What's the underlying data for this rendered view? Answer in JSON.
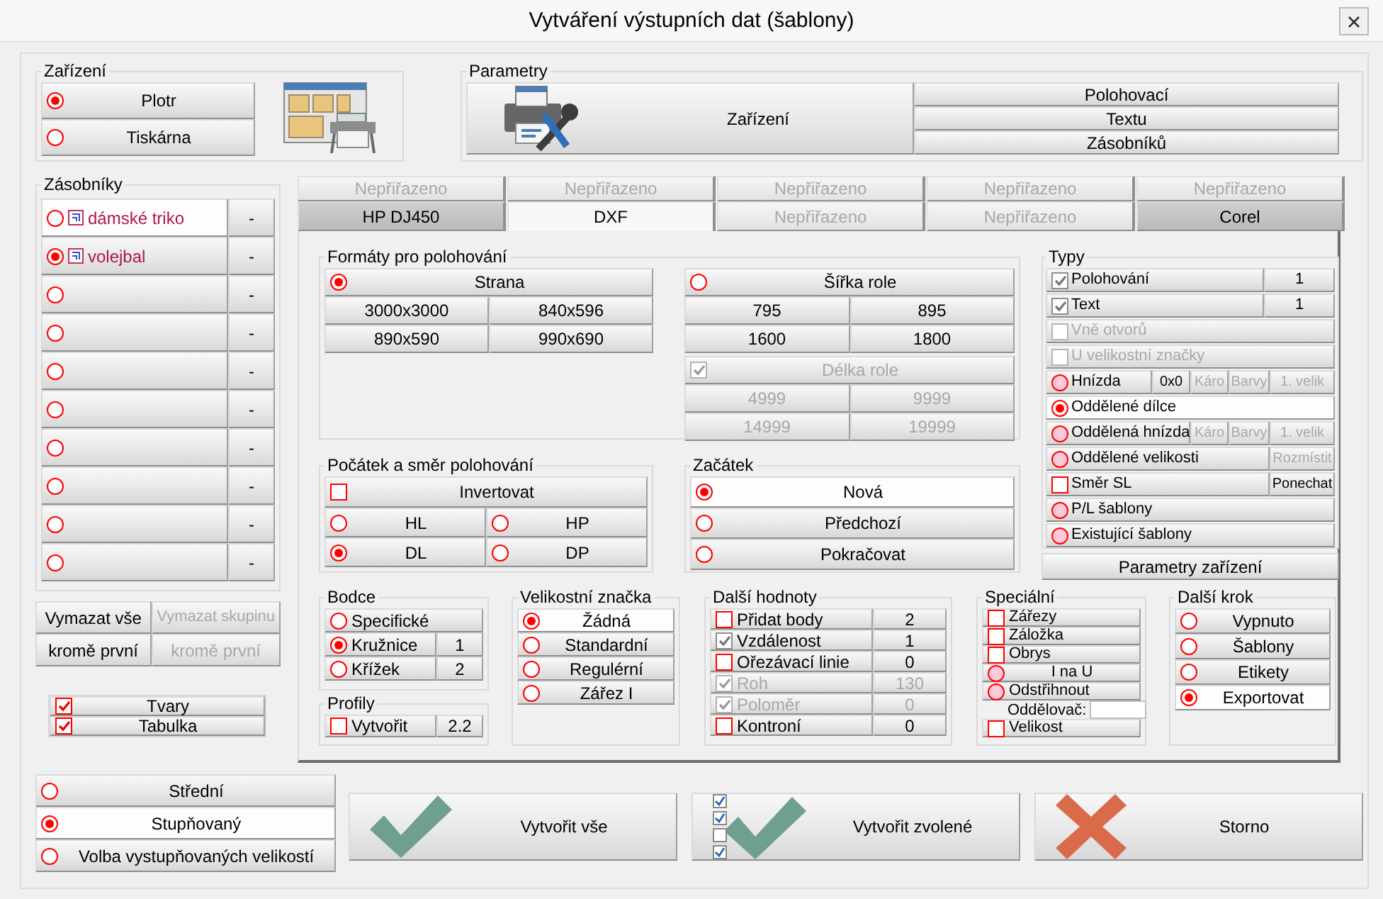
{
  "window": {
    "title": "Vytváření výstupních dat (šablony)"
  },
  "device": {
    "title": "Zařízení",
    "options": [
      {
        "label": "Plotr",
        "selected": true
      },
      {
        "label": "Tiskárna",
        "selected": false
      }
    ]
  },
  "parameters": {
    "title": "Parametry",
    "main_button": "Zařízení",
    "buttons": [
      "Polohovací",
      "Textu",
      "Zásobníků"
    ]
  },
  "bins": {
    "title": "Zásobníky",
    "items": [
      {
        "label": "dámské triko",
        "selected": false,
        "highlighted": true,
        "action": "-"
      },
      {
        "label": "volejbal",
        "selected": true,
        "highlighted": false,
        "action": "-"
      },
      {
        "selected": false,
        "highlighted": false,
        "action": "-"
      },
      {
        "selected": false,
        "highlighted": false,
        "action": "-"
      },
      {
        "selected": false,
        "highlighted": false,
        "action": "-"
      },
      {
        "selected": false,
        "highlighted": false,
        "action": "-"
      },
      {
        "selected": false,
        "highlighted": false,
        "action": "-"
      },
      {
        "selected": false,
        "highlighted": false,
        "action": "-"
      },
      {
        "selected": false,
        "highlighted": false,
        "action": "-"
      },
      {
        "selected": false,
        "highlighted": false,
        "action": "-"
      }
    ]
  },
  "clear_buttons": [
    {
      "label": "Vymazat vše",
      "disabled": false
    },
    {
      "label": "Vymazat skupinu",
      "disabled": true
    },
    {
      "label": "kromě první",
      "disabled": false
    },
    {
      "label": "kromě první",
      "disabled": true
    }
  ],
  "outputs": [
    {
      "label": "Tvary",
      "checked": true
    },
    {
      "label": "Tabulka",
      "checked": true
    }
  ],
  "tabs": {
    "row_1": [
      {
        "label": "Nepřiřazeno",
        "selected": false,
        "disabled": true
      },
      {
        "label": "Nepřiřazeno",
        "selected": false,
        "disabled": true
      },
      {
        "label": "Nepřiřazeno",
        "selected": false,
        "disabled": true
      },
      {
        "label": "Nepřiřazeno",
        "selected": false,
        "disabled": true
      },
      {
        "label": "Nepřiřazeno",
        "selected": false,
        "disabled": true
      }
    ],
    "row_2": [
      {
        "label": "HP DJ450",
        "selected": false,
        "disabled": false
      },
      {
        "label": "DXF",
        "selected": true,
        "disabled": false
      },
      {
        "label": "Nepřiřazeno",
        "selected": false,
        "disabled": true
      },
      {
        "label": "Nepřiřazeno",
        "selected": false,
        "disabled": true
      },
      {
        "label": "Corel",
        "selected": false,
        "disabled": false
      }
    ]
  },
  "formats": {
    "title": "Formáty pro polohování",
    "page": {
      "label": "Strana",
      "selected": true,
      "sizes": [
        "3000x3000",
        "840x596",
        "890x590",
        "990x690"
      ]
    },
    "roll_width": {
      "label": "Šířka role",
      "selected": false,
      "sizes": [
        "795",
        "895",
        "1600",
        "1800"
      ]
    },
    "roll_length": {
      "label": "Délka role",
      "checked": true,
      "disabled": true,
      "sizes": [
        "4999",
        "9999",
        "14999",
        "19999"
      ]
    }
  },
  "origin": {
    "title": "Počátek a směr polohování",
    "invert": {
      "label": "Invertovat",
      "checked": false
    },
    "corners": [
      {
        "label": "HL",
        "selected": false
      },
      {
        "label": "HP",
        "selected": false
      },
      {
        "label": "DL",
        "selected": true
      },
      {
        "label": "DP",
        "selected": false
      }
    ]
  },
  "start": {
    "title": "Začátek",
    "options": [
      {
        "label": "Nová",
        "selected": true
      },
      {
        "label": "Předchozí",
        "selected": false
      },
      {
        "label": "Pokračovat",
        "selected": false
      }
    ]
  },
  "types": {
    "title": "Typy",
    "rows": [
      {
        "kind": "check",
        "label": "Polohování",
        "checked": true,
        "disabled": false,
        "value": "1"
      },
      {
        "kind": "check",
        "label": "Text",
        "checked": true,
        "disabled": false,
        "value": "1"
      },
      {
        "kind": "check",
        "label": "Vně otvorů",
        "checked": false,
        "disabled": true
      },
      {
        "kind": "check",
        "label": "U velikostní značky",
        "checked": false,
        "disabled": true
      },
      {
        "kind": "radio",
        "label": "Hnízda",
        "selected": false,
        "extras": [
          {
            "label": "0x0",
            "disabled": false
          },
          {
            "label": "Káro",
            "disabled": true
          },
          {
            "label": "Barvy",
            "disabled": true
          },
          {
            "label": "1. velik",
            "disabled": true
          }
        ]
      },
      {
        "kind": "radio",
        "label": "Oddělené dílce",
        "selected": true
      },
      {
        "kind": "radio",
        "label": "Oddělená hnízda",
        "selected": false,
        "extras": [
          {
            "label": "Káro",
            "disabled": true
          },
          {
            "label": "Barvy",
            "disabled": true
          },
          {
            "label": "1. velik",
            "disabled": true
          }
        ]
      },
      {
        "kind": "radio",
        "label": "Oddělené velikosti",
        "selected": false,
        "extras": [
          {
            "label": "Rozmístit",
            "disabled": true
          }
        ]
      },
      {
        "kind": "check",
        "label": "Směr SL",
        "checked": false,
        "disabled": false,
        "extras": [
          {
            "label": "Ponechat",
            "disabled": false
          }
        ]
      },
      {
        "kind": "radio",
        "label": "P/L šablony",
        "selected": false
      },
      {
        "kind": "radio",
        "label": "Existující šablony",
        "selected": false
      }
    ]
  },
  "device_parameters_button": "Parametry zařízení",
  "spikes": {
    "title": "Bodce",
    "options": [
      {
        "label": "Specifické",
        "selected": false
      },
      {
        "label": "Kružnice",
        "selected": true,
        "value": "1"
      },
      {
        "label": "Křížek",
        "selected": false,
        "value": "2"
      }
    ]
  },
  "profiles": {
    "title": "Profily",
    "create": {
      "label": "Vytvořit",
      "checked": false,
      "value": "2.2"
    }
  },
  "size_mark": {
    "title": "Velikostní značka",
    "options": [
      {
        "label": "Žádná",
        "selected": true
      },
      {
        "label": "Standardní",
        "selected": false
      },
      {
        "label": "Regulérní",
        "selected": false
      },
      {
        "label": "Zářez I",
        "selected": false
      }
    ]
  },
  "more_values": {
    "title": "Další hodnoty",
    "rows": [
      {
        "label": "Přidat body",
        "checked": false,
        "disabled": false,
        "value": "2"
      },
      {
        "label": "Vzdálenost",
        "checked": true,
        "disabled": false,
        "value": "1"
      },
      {
        "label": "Ořezávací linie",
        "checked": false,
        "disabled": false,
        "value": "0"
      },
      {
        "label": "Roh",
        "checked": true,
        "disabled": true,
        "value": "130"
      },
      {
        "label": "Poloměr",
        "checked": true,
        "disabled": true,
        "value": "0"
      },
      {
        "label": "Kontroní",
        "checked": false,
        "disabled": false,
        "value": "0"
      }
    ]
  },
  "special": {
    "title": "Speciální",
    "rows": [
      {
        "kind": "check",
        "label": "Zářezy",
        "checked": false
      },
      {
        "kind": "check",
        "label": "Záložka",
        "checked": false
      },
      {
        "kind": "check",
        "label": "Obrys",
        "checked": false
      },
      {
        "kind": "radio",
        "label": "I na U",
        "selected": false
      },
      {
        "kind": "radio",
        "label": "Odstřihnout",
        "selected": false
      },
      {
        "kind": "field",
        "label": "Oddělovač:"
      },
      {
        "kind": "check",
        "label": "Velikost",
        "checked": false
      }
    ]
  },
  "next_step": {
    "title": "Další krok",
    "options": [
      {
        "label": "Vypnuto",
        "selected": false
      },
      {
        "label": "Šablony",
        "selected": false
      },
      {
        "label": "Etikety",
        "selected": false
      },
      {
        "label": "Exportovat",
        "selected": true
      }
    ]
  },
  "grading": [
    {
      "label": "Střední",
      "selected": false
    },
    {
      "label": "Stupňovaný",
      "selected": true
    },
    {
      "label": "Volba vystupňovaných velikostí",
      "selected": false
    }
  ],
  "actions": [
    {
      "kind": "check",
      "label": "Vytvořit vše"
    },
    {
      "kind": "checklist",
      "label": "Vytvořit zvolené"
    },
    {
      "kind": "cross",
      "label": "Storno"
    }
  ]
}
